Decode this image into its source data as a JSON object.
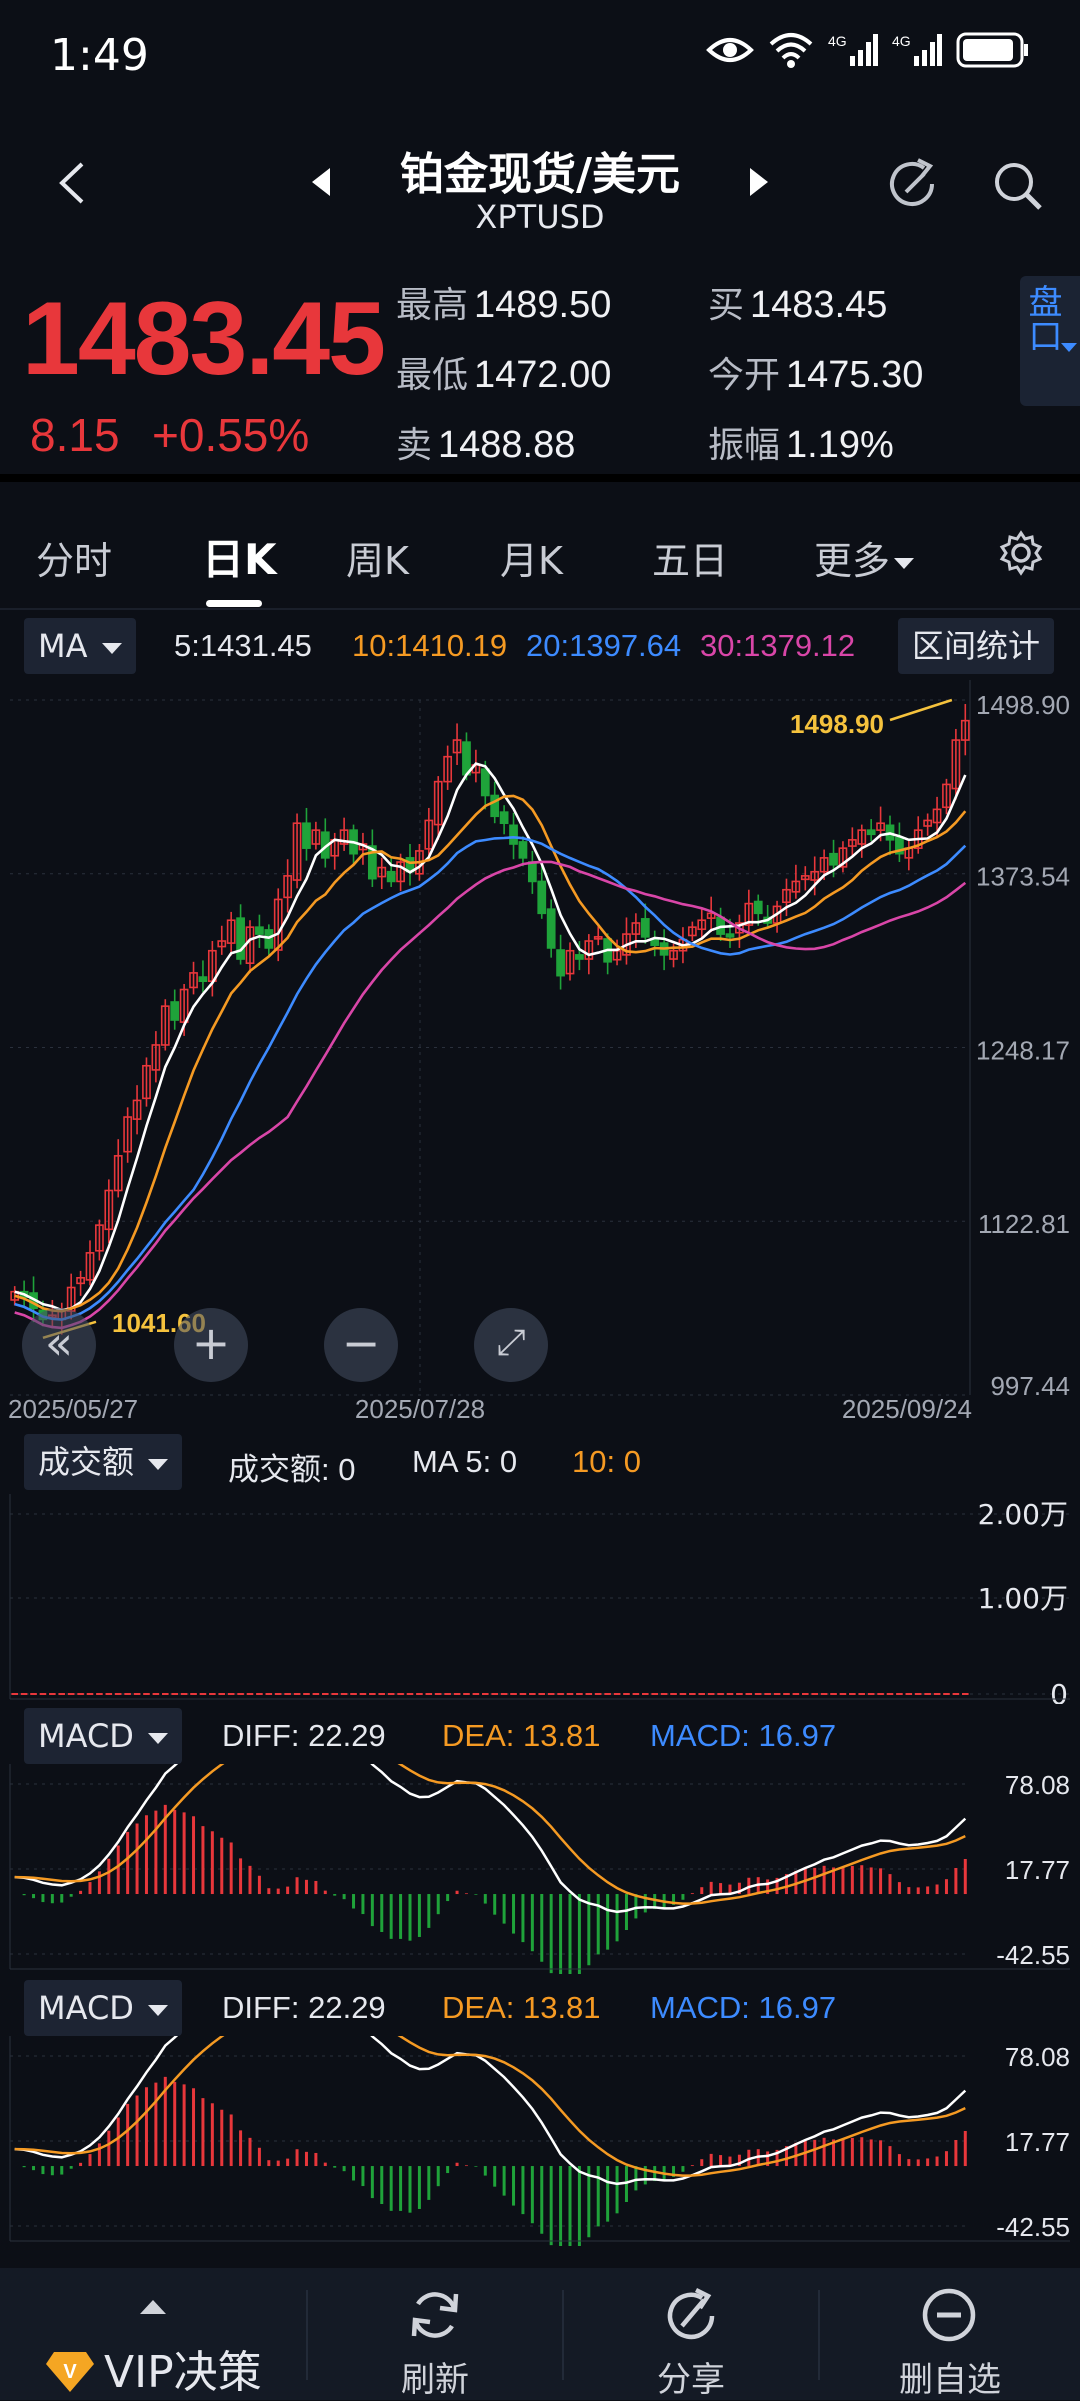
{
  "status": {
    "time": "1:49"
  },
  "header": {
    "title": "铂金现货/美元",
    "subtitle": "XPTUSD"
  },
  "quote": {
    "price": "1483.45",
    "change": "8.15",
    "change_pct": "+0.55%",
    "cells": [
      {
        "label": "最高",
        "value": "1489.50"
      },
      {
        "label": "买",
        "value": "1483.45"
      },
      {
        "label": "最低",
        "value": "1472.00"
      },
      {
        "label": "今开",
        "value": "1475.30"
      },
      {
        "label": "卖",
        "value": "1488.88"
      },
      {
        "label": "振幅",
        "value": "1.19%"
      }
    ],
    "pankou": "盘口"
  },
  "tabs": [
    "分时",
    "日K",
    "周K",
    "月K",
    "五日",
    "更多"
  ],
  "ma_bar": {
    "selector": "MA",
    "ma5": "5:1431.45",
    "ma10": "10:1410.19",
    "ma20": "20:1397.64",
    "ma30": "30:1379.12",
    "range_btn": "区间统计"
  },
  "colors": {
    "up": "#e8373b",
    "down": "#1fa33a",
    "ma5": "#ffffff",
    "ma10": "#f59a23",
    "ma20": "#3d8bff",
    "ma30": "#d946a8"
  },
  "chart_data": [
    {
      "type": "candlestick",
      "y_ticks": [
        "1498.90",
        "1373.54",
        "1248.17",
        "1122.81",
        "997.44"
      ],
      "x_ticks": [
        "2025/05/27",
        "2025/07/28",
        "2025/09/24"
      ],
      "ylim": [
        997.44,
        1498.9
      ],
      "max_label": "1498.90",
      "min_label": "1041.60",
      "closes": [
        1072,
        1068,
        1060,
        1052,
        1055,
        1058,
        1075,
        1082,
        1100,
        1120,
        1145,
        1170,
        1198,
        1210,
        1235,
        1250,
        1278,
        1268,
        1290,
        1302,
        1296,
        1318,
        1325,
        1340,
        1312,
        1335,
        1330,
        1320,
        1355,
        1372,
        1410,
        1392,
        1405,
        1385,
        1398,
        1405,
        1388,
        1395,
        1370,
        1378,
        1368,
        1382,
        1375,
        1390,
        1412,
        1440,
        1458,
        1470,
        1445,
        1452,
        1430,
        1415,
        1410,
        1395,
        1385,
        1368,
        1345,
        1320,
        1300,
        1318,
        1312,
        1325,
        1328,
        1310,
        1318,
        1330,
        1338,
        1328,
        1322,
        1315,
        1318,
        1326,
        1335,
        1340,
        1345,
        1330,
        1328,
        1338,
        1352,
        1345,
        1338,
        1350,
        1362,
        1368,
        1372,
        1375,
        1385,
        1380,
        1392,
        1398,
        1405,
        1402,
        1410,
        1398,
        1388,
        1392,
        1405,
        1412,
        1420,
        1438,
        1470,
        1484
      ],
      "ma5_last": 1431.45,
      "ma10_last": 1410.19,
      "ma20_last": 1397.64,
      "ma30_last": 1379.12
    },
    {
      "type": "bar",
      "title": "成交额",
      "y_ticks": [
        "2.00万",
        "1.00万",
        "0"
      ],
      "values_note": "all 0"
    },
    {
      "type": "macd",
      "diff": 22.29,
      "dea": 13.81,
      "macd": 16.97,
      "y_ticks": [
        "78.08",
        "17.77",
        "-42.55"
      ],
      "ylim": [
        -42.55,
        78.08
      ]
    }
  ],
  "volume_bar": {
    "selector": "成交额",
    "label": "成交额: 0",
    "ma5": "MA 5: 0",
    "ma10": "10: 0"
  },
  "macd_bar": {
    "selector": "MACD",
    "diff": "DIFF: 22.29",
    "dea": "DEA: 13.81",
    "macd": "MACD: 16.97"
  },
  "bottom": {
    "vip": "VIP决策",
    "refresh": "刷新",
    "share": "分享",
    "remove": "删自选"
  }
}
